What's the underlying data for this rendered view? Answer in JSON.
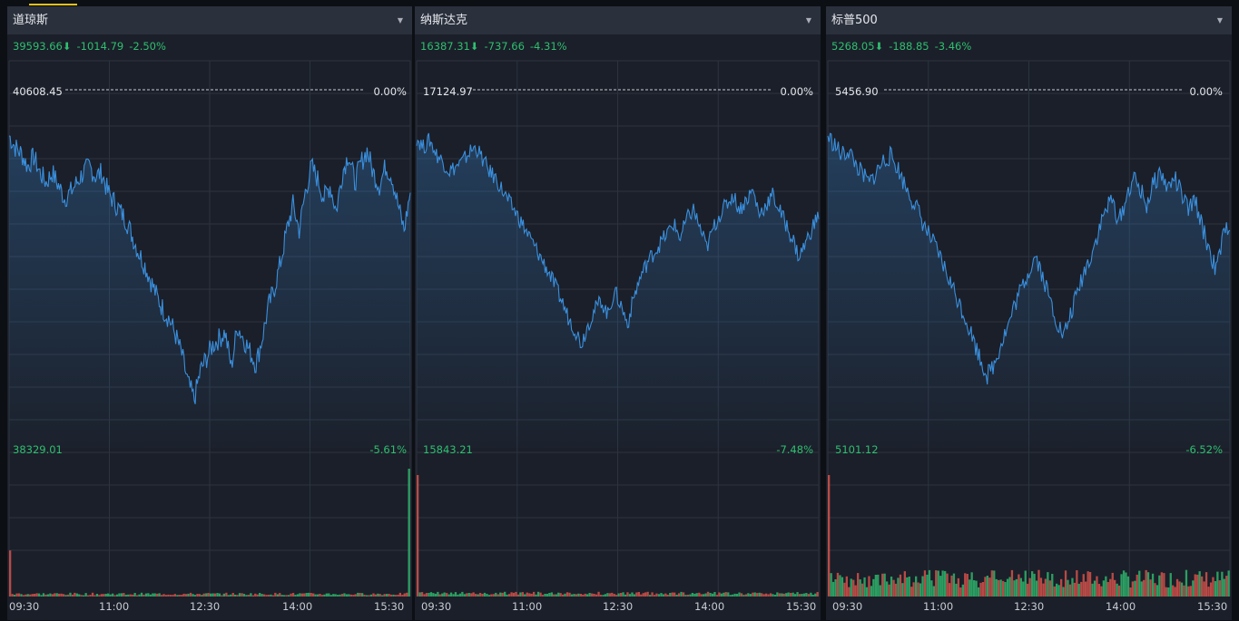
{
  "colors": {
    "down": "#2fbf71",
    "up": "#e0554d",
    "line": "#3a8fdd",
    "grid": "#2c3340",
    "header_bg": "#2a303c",
    "panel_bg": "#1b1f29",
    "accent": "#e8c21b"
  },
  "panels": [
    {
      "title": "道琼斯",
      "price": "39593.66",
      "arrow": "⬇",
      "change": "-1014.79",
      "change_pct": "-2.50%",
      "ref_price": "40608.45",
      "ref_pct": "0.00%",
      "low_price": "38329.01",
      "low_pct": "-5.61%",
      "times": [
        "09:30",
        "11:00",
        "12:30",
        "14:00",
        "15:30"
      ],
      "chart_data": {
        "type": "line",
        "series": [
          {
            "values": [
              -0.72,
              -0.9,
              -1.0,
              -1.2,
              -1.05,
              -1.3,
              -1.45,
              -1.3,
              -1.5,
              -1.7,
              -1.6,
              -1.45,
              -1.3,
              -1.2,
              -1.35,
              -1.3,
              -1.6,
              -1.75,
              -1.9,
              -2.05,
              -2.3,
              -2.55,
              -2.75,
              -3.0,
              -3.25,
              -3.45,
              -3.6,
              -3.85,
              -4.15,
              -4.6,
              -4.85,
              -4.4,
              -4.2,
              -4.0,
              -3.9,
              -3.8,
              -4.35,
              -3.7,
              -3.9,
              -4.1,
              -4.3,
              -3.9,
              -3.4,
              -3.1,
              -2.7,
              -2.2,
              -1.8,
              -2.2,
              -1.6,
              -1.2,
              -1.4,
              -1.7,
              -1.5,
              -1.9,
              -1.3,
              -1.0,
              -1.45,
              -1.15,
              -0.95,
              -1.3,
              -1.5,
              -1.2,
              -1.35,
              -1.8,
              -2.2,
              -1.6
            ],
            "name": ""
          }
        ],
        "ylim": [
          -5.61,
          0
        ],
        "ref": 40608.45,
        "volume": {
          "spike_start": 0.36,
          "spike_end": 1.0,
          "base": 0.02
        }
      }
    },
    {
      "title": "纳斯达克",
      "price": "16387.31",
      "arrow": "⬇",
      "change": "-737.66",
      "change_pct": "-4.31%",
      "ref_price": "17124.97",
      "ref_pct": "0.00%",
      "low_price": "15843.21",
      "low_pct": "-7.48%",
      "times": [
        "09:30",
        "11:00",
        "12:30",
        "14:00",
        "15:30"
      ],
      "chart_data": {
        "type": "line",
        "series": [
          {
            "values": [
              -1.0,
              -1.2,
              -1.05,
              -1.35,
              -1.5,
              -1.7,
              -1.6,
              -1.5,
              -1.3,
              -1.2,
              -1.45,
              -1.7,
              -1.85,
              -2.1,
              -2.35,
              -2.55,
              -2.8,
              -3.05,
              -3.3,
              -3.55,
              -3.8,
              -4.1,
              -4.4,
              -4.75,
              -5.0,
              -5.3,
              -4.9,
              -4.6,
              -4.4,
              -4.7,
              -4.2,
              -4.5,
              -4.9,
              -4.3,
              -3.9,
              -3.6,
              -3.4,
              -3.2,
              -3.0,
              -2.8,
              -3.1,
              -2.7,
              -2.5,
              -2.9,
              -3.3,
              -2.9,
              -2.6,
              -2.4,
              -2.2,
              -2.5,
              -2.3,
              -2.1,
              -2.6,
              -2.4,
              -2.2,
              -2.5,
              -2.8,
              -3.1,
              -3.5,
              -3.2,
              -2.9,
              -2.6
            ],
            "name": ""
          }
        ],
        "ylim": [
          -7.48,
          0
        ],
        "ref": 17124.97,
        "volume": {
          "spike_start": 0.95,
          "spike_end": 0.0,
          "base": 0.025
        }
      }
    },
    {
      "title": "标普500",
      "price": "5268.05",
      "arrow": "⬇",
      "change": "-188.85",
      "change_pct": "-3.46%",
      "ref_price": "5456.90",
      "ref_pct": "0.00%",
      "low_price": "5101.12",
      "low_pct": "-6.52%",
      "times": [
        "09:30",
        "11:00",
        "12:30",
        "14:00",
        "15:30"
      ],
      "chart_data": {
        "type": "line",
        "series": [
          {
            "values": [
              -0.85,
              -1.0,
              -1.2,
              -1.1,
              -1.35,
              -1.55,
              -1.7,
              -1.5,
              -1.3,
              -1.2,
              -1.4,
              -1.7,
              -1.95,
              -2.2,
              -2.5,
              -2.75,
              -3.0,
              -3.3,
              -3.6,
              -3.9,
              -4.2,
              -4.55,
              -4.9,
              -5.2,
              -5.0,
              -4.6,
              -4.3,
              -3.9,
              -3.6,
              -3.3,
              -3.0,
              -3.4,
              -3.8,
              -4.2,
              -4.5,
              -4.1,
              -3.7,
              -3.3,
              -3.0,
              -2.6,
              -2.2,
              -2.0,
              -2.4,
              -2.0,
              -1.6,
              -1.8,
              -2.1,
              -1.7,
              -1.5,
              -1.8,
              -1.6,
              -1.9,
              -2.2,
              -2.0,
              -2.5,
              -2.9,
              -3.3,
              -2.7,
              -2.4
            ],
            "name": ""
          }
        ],
        "ylim": [
          -6.52,
          0
        ],
        "ref": 5456.9,
        "volume": {
          "spike_start": 0.95,
          "spike_end": 0.2,
          "base": 0.14
        }
      }
    }
  ]
}
